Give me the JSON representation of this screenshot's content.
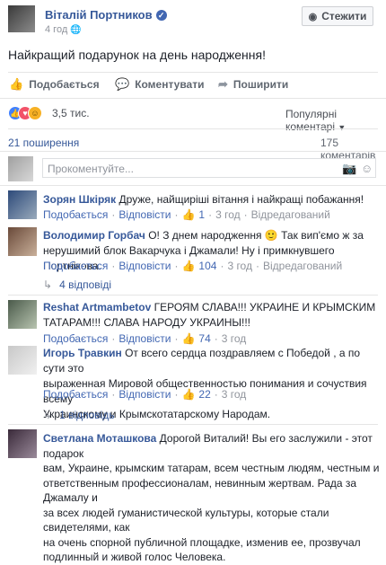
{
  "post": {
    "author": "Віталій Портников",
    "time": "4 год",
    "text": "Найкращий подарунок на день народження!",
    "follow_label": "Стежити"
  },
  "actions": {
    "like": "Подобається",
    "comment": "Коментувати",
    "share": "Поширити"
  },
  "summary": {
    "reactions_count": "3,5 тис.",
    "sort_label": "Популярні коментарі",
    "shares": "21 поширення",
    "comments": "175 коментарів"
  },
  "comment_input": {
    "placeholder": "Прокоментуйте..."
  },
  "comments": [
    {
      "author": "Зорян Шкіряк",
      "text": "Друже, найщиріші вітання і найкращі побажання!",
      "like": "Подобається",
      "reply": "Відповісти",
      "likes": "1",
      "time": "3 год",
      "edited": "Відредагований"
    },
    {
      "author": "Володимир Горбач",
      "text_line1": "О! З днем народження 🙂 Так вип'ємо ж за",
      "text_line2": "нерушимий блок Вакарчука і Джамали! Ну і примкнувшего Портнікова.",
      "like": "Подобається",
      "reply": "Відповісти",
      "likes": "104",
      "time": "3 год",
      "edited": "Відредагований",
      "replies": "4 відповіді"
    },
    {
      "author": "Reshat Artmambetov",
      "text_line1": "ГЕРОЯМ СЛАВА!!! УКРАИНЕ И КРЫМСКИМ",
      "text_line2": "ТАТАРАМ!!! СЛАВА НАРОДУ УКРАИНЫ!!!",
      "like": "Подобається",
      "reply": "Відповісти",
      "likes": "74",
      "time": "3 год"
    },
    {
      "author": "Игорь Травкин",
      "text_line1": "От всего сердца поздравляем с Победой , а по сути это",
      "text_line2": "выраженная Мировой общественностью понимания и сочуствия всему",
      "text_line3": "Украинскому и Крымскотатарскому Народам.",
      "like": "Подобається",
      "reply": "Відповісти",
      "likes": "22",
      "time": "3 год",
      "replies": "1 відповідь"
    },
    {
      "author": "Светлана Моташкова",
      "text_line1": "Дорогой Виталий! Вы его заслужили - этот подарок",
      "text_line2": "вам, Украине, крымским татарам, всем честным людям, честным и",
      "text_line3": "ответственным профессионалам, невинным жертвам. Рада за Джамалу и",
      "text_line4": "за всех людей гуманистической культуры, которые стали свидетелями, как",
      "text_line5": "на очень спорной публичной площадке, изменив ее, прозвучал",
      "text_line6": "подлинный и живой голос Человека."
    }
  ]
}
